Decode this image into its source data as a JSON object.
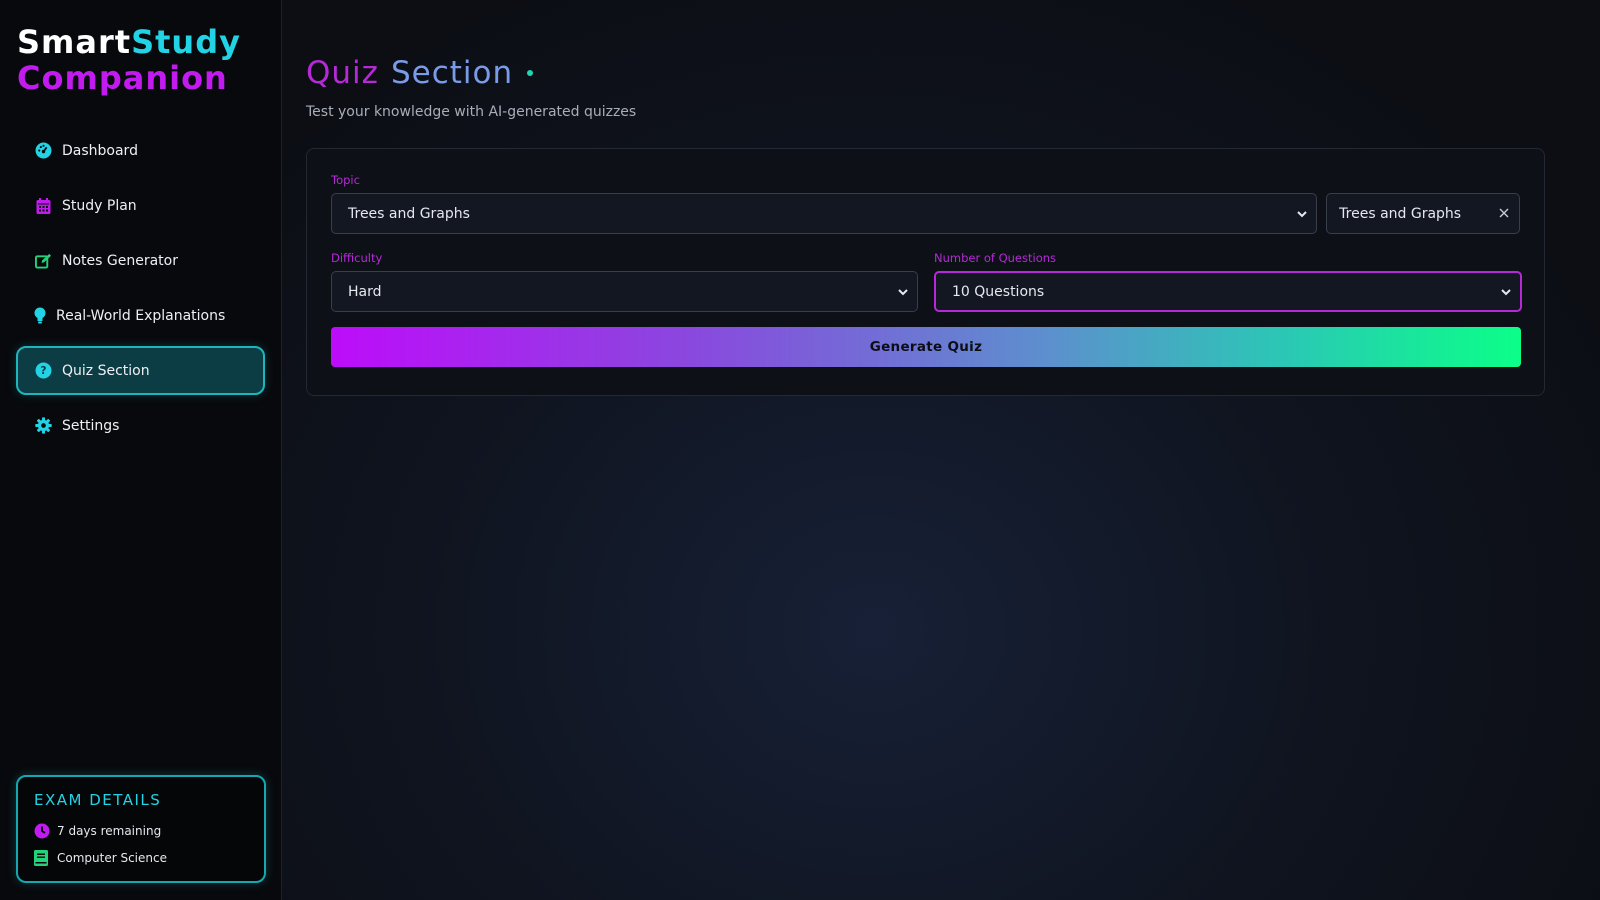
{
  "brand": {
    "part1": "Smart",
    "part2": "Study",
    "part3": "Companion"
  },
  "sidebar": {
    "items": [
      {
        "label": "Dashboard",
        "icon": "dashboard-gauge-icon"
      },
      {
        "label": "Study Plan",
        "icon": "calendar-icon"
      },
      {
        "label": "Notes Generator",
        "icon": "edit-icon"
      },
      {
        "label": "Real-World Explanations",
        "icon": "lightbulb-icon"
      },
      {
        "label": "Quiz Section",
        "icon": "question-circle-icon",
        "active": true
      },
      {
        "label": "Settings",
        "icon": "gear-icon"
      }
    ]
  },
  "exam": {
    "title": "EXAM DETAILS",
    "days_remaining": "7 days remaining",
    "subject": "Computer Science"
  },
  "page": {
    "title_part1": "Quiz",
    "title_part2": "Section",
    "subtitle": "Test your knowledge with AI-generated quizzes"
  },
  "form": {
    "topic_label": "Topic",
    "topic_value": "Trees and Graphs",
    "topic_chip": "Trees and Graphs",
    "difficulty_label": "Difficulty",
    "difficulty_value": "Hard",
    "questions_label": "Number of Questions",
    "questions_value": "10 Questions",
    "generate_label": "Generate Quiz"
  },
  "colors": {
    "accent_purple": "#b52ad6",
    "accent_cyan": "#22d3e6",
    "accent_green": "#22d37a",
    "background": "#0c0e14"
  }
}
